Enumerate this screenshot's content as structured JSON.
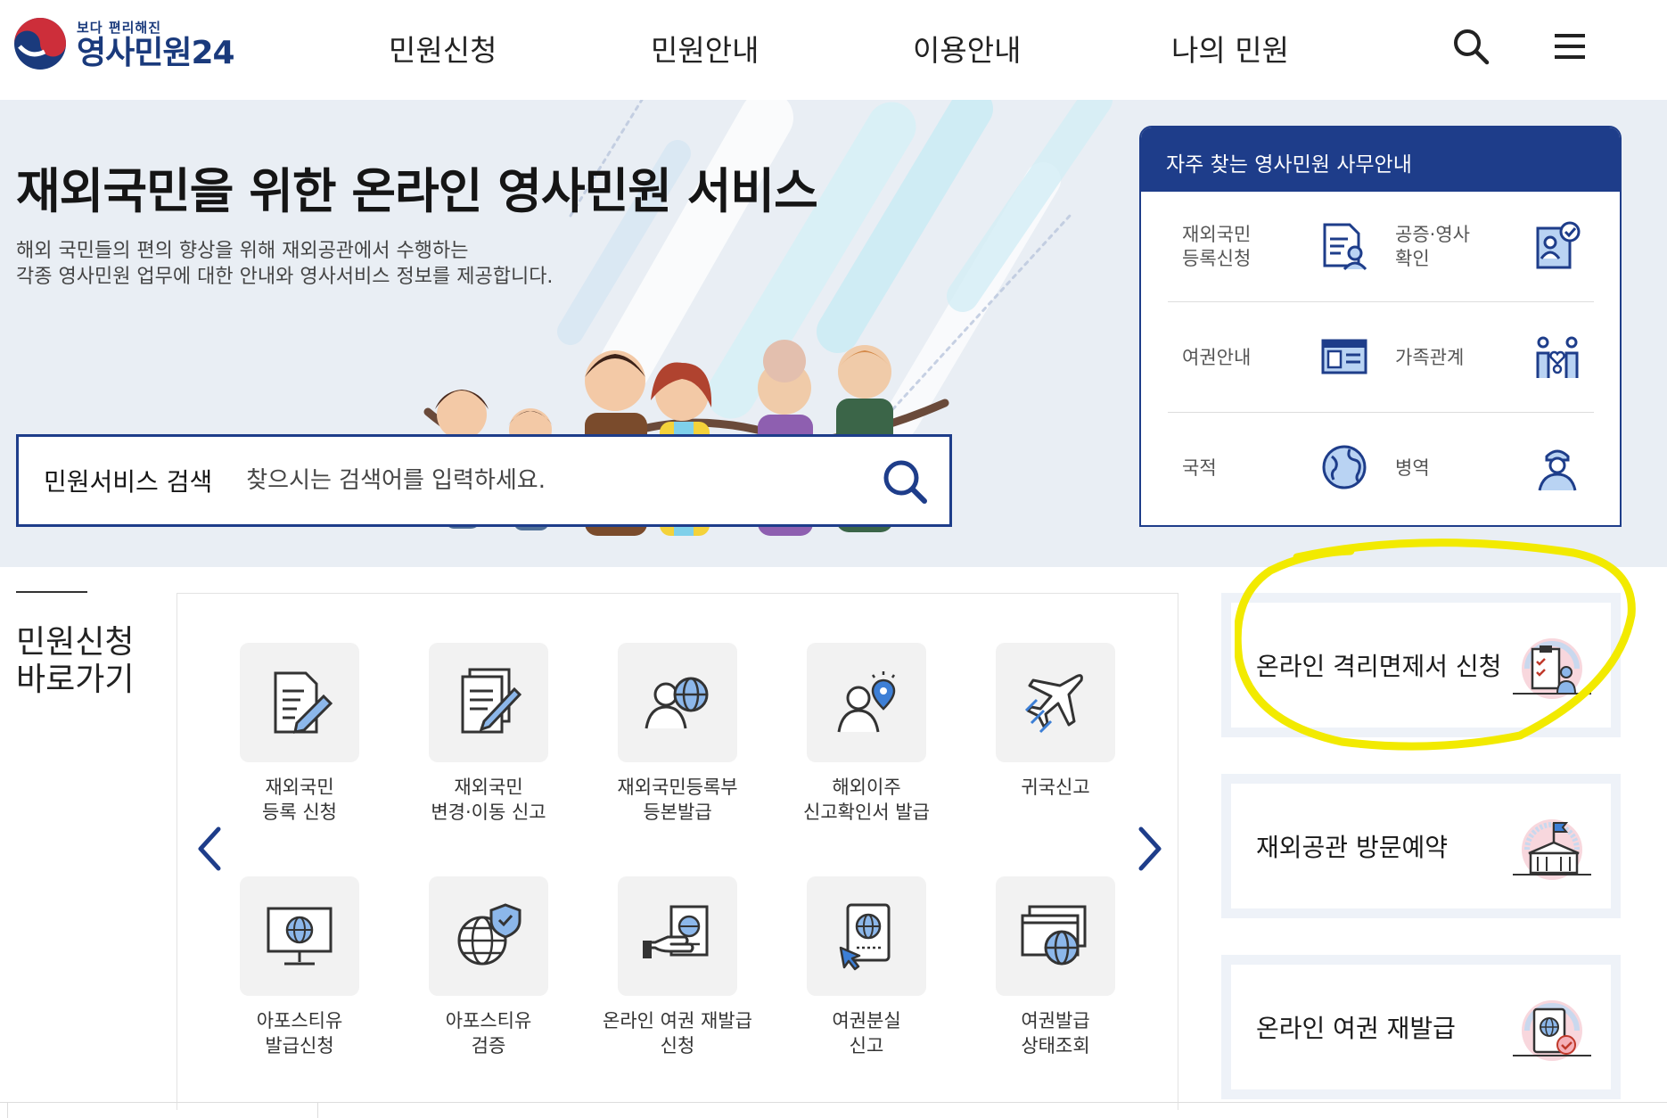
{
  "header": {
    "logo_small": "보다 편리해진",
    "logo_big": "영사민원24",
    "nav": [
      "민원신청",
      "민원안내",
      "이용안내",
      "나의 민원"
    ],
    "icons": [
      "search-icon",
      "menu-icon"
    ]
  },
  "hero": {
    "title": "재외국민을 위한 온라인 영사민원 서비스",
    "desc_line1": "해외 국민들의 편의 향상을 위해 재외공관에서 수행하는",
    "desc_line2": "각종 영사민원 업무에 대한 안내와 영사서비스 정보를 제공합니다.",
    "search_label": "민원서비스 검색",
    "search_placeholder": "찾으시는 검색어를 입력하세요."
  },
  "office": {
    "title": "자주 찾는 영사민원 사무안내",
    "items": [
      {
        "line1": "재외국민",
        "line2": "등록신청",
        "icon": "document-person-icon"
      },
      {
        "line1": "공증·영사",
        "line2": "확인",
        "icon": "certificate-check-icon"
      },
      {
        "line1": "여권안내",
        "line2": "",
        "icon": "passport-card-icon"
      },
      {
        "line1": "가족관계",
        "line2": "",
        "icon": "family-icon"
      },
      {
        "line1": "국적",
        "line2": "",
        "icon": "globe-icon"
      },
      {
        "line1": "병역",
        "line2": "",
        "icon": "soldier-icon"
      }
    ]
  },
  "shortcuts": {
    "title_line1": "민원신청",
    "title_line2": "바로가기",
    "tiles": [
      {
        "line1": "재외국민",
        "line2": "등록 신청",
        "icon": "form-pen-icon"
      },
      {
        "line1": "재외국민",
        "line2": "변경·이동 신고",
        "icon": "document-edit-icon"
      },
      {
        "line1": "재외국민등록부",
        "line2": "등본발급",
        "icon": "person-globe-icon"
      },
      {
        "line1": "해외이주",
        "line2": "신고확인서 발급",
        "icon": "person-location-icon"
      },
      {
        "line1": "귀국신고",
        "line2": "",
        "icon": "airplane-icon"
      },
      {
        "line1": "아포스티유",
        "line2": "발급신청",
        "icon": "monitor-globe-icon"
      },
      {
        "line1": "아포스티유",
        "line2": "검증",
        "icon": "globe-shield-icon"
      },
      {
        "line1": "온라인 여권 재발급",
        "line2": "신청",
        "icon": "hand-passport-icon"
      },
      {
        "line1": "여권분실",
        "line2": "신고",
        "icon": "passport-cursor-icon"
      },
      {
        "line1": "여권발급",
        "line2": "상태조회",
        "icon": "windows-globe-icon"
      }
    ]
  },
  "quick_cards": [
    {
      "label": "온라인 격리면제서 신청",
      "icon": "clipboard-person-icon"
    },
    {
      "label": "재외공관 방문예약",
      "icon": "embassy-building-icon"
    },
    {
      "label": "온라인 여권 재발급",
      "icon": "passport-check-icon"
    }
  ],
  "colors": {
    "brand_navy": "#1e3d8a",
    "hero_bg": "#e9eef4",
    "highlight_yellow": "#f2ea00",
    "accent_blue": "#3d7fd6"
  }
}
